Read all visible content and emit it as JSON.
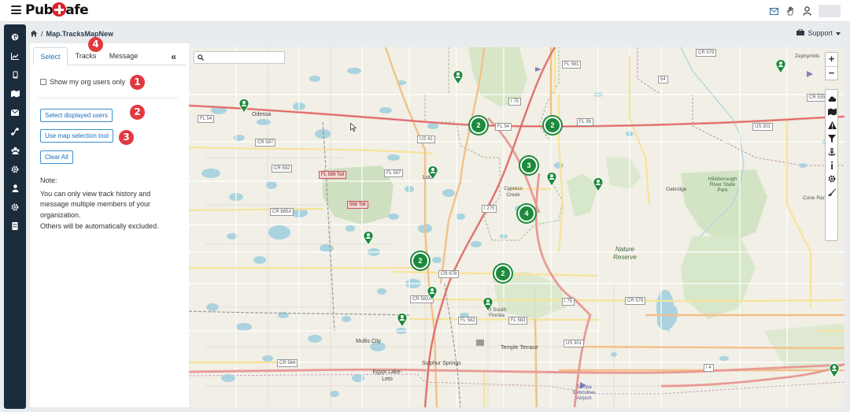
{
  "app": {
    "logo_text_left": "Pub",
    "logo_text_right": "afe"
  },
  "breadcrumb": {
    "title": "Map.TracksMapNew"
  },
  "support": {
    "label": "Support"
  },
  "panel": {
    "tabs": [
      {
        "label": "Select",
        "active": true
      },
      {
        "label": "Tracks",
        "active": false
      },
      {
        "label": "Message",
        "active": false
      }
    ],
    "collapse_glyph": "«",
    "checkbox_label": "Show my org users only",
    "checkbox_checked": false,
    "buttons": {
      "select_displayed": "Select displayed users",
      "map_selection": "Use map selection tool",
      "clear_all": "Clear All"
    },
    "note_title": "Note:",
    "note_lines": [
      "You can only view track history and",
      "message multiple members of your",
      "organization.",
      "Others will be automatically excluded."
    ]
  },
  "callouts": [
    "1",
    "2",
    "3",
    "4"
  ],
  "map": {
    "search_placeholder": "",
    "zoom_in": "+",
    "zoom_out": "−",
    "clusters": [
      "2",
      "2",
      "3",
      "4",
      "2",
      "2"
    ],
    "places": {
      "zephyrhills": "Zephyrhills",
      "odessa": "Odessa",
      "lutz": "Lutz",
      "cypress_creek": "Cypress Creek",
      "oakridge": "Oakridge",
      "hillsborough": "Hillsborough River State Park",
      "cone_ranch": "Cone Ran",
      "nature_reserve": "Nature Reserve",
      "usf": "of South Florida",
      "temple_terrace": "Temple Terrace",
      "mullis_city": "Mullis City",
      "sulphur_springs": "Sulphur Springs",
      "egypt_lake": "Egypt Lake-Leto",
      "tampa_airport": "Tampa Executive Airport"
    },
    "shields": {
      "fl54_w": "FL 54",
      "fl54_c": "FL 54",
      "fl56": "FL 56",
      "us41": "US 41",
      "us301_n": "US 301",
      "us301_s": "US 301",
      "cr587": "CR 587",
      "cr582": "CR 582",
      "fl589": "FL 589 Toll",
      "fl597": "FL 597",
      "toll568": "568 Toll",
      "cr685a": "CR 685A",
      "cr678": "CR 678",
      "cr582a": "CR 582A",
      "fl582": "FL 582",
      "fl583": "FL 583",
      "i275_n": "I 75",
      "i275_c": "I 275",
      "i75_s": "I 75",
      "cr579_n": "CR 579",
      "cr579_s": "CR 579",
      "cr535": "CR 535",
      "cr584": "CR 584",
      "i4": "I 4",
      "r581": "FL 581",
      "r54e": "54"
    }
  }
}
